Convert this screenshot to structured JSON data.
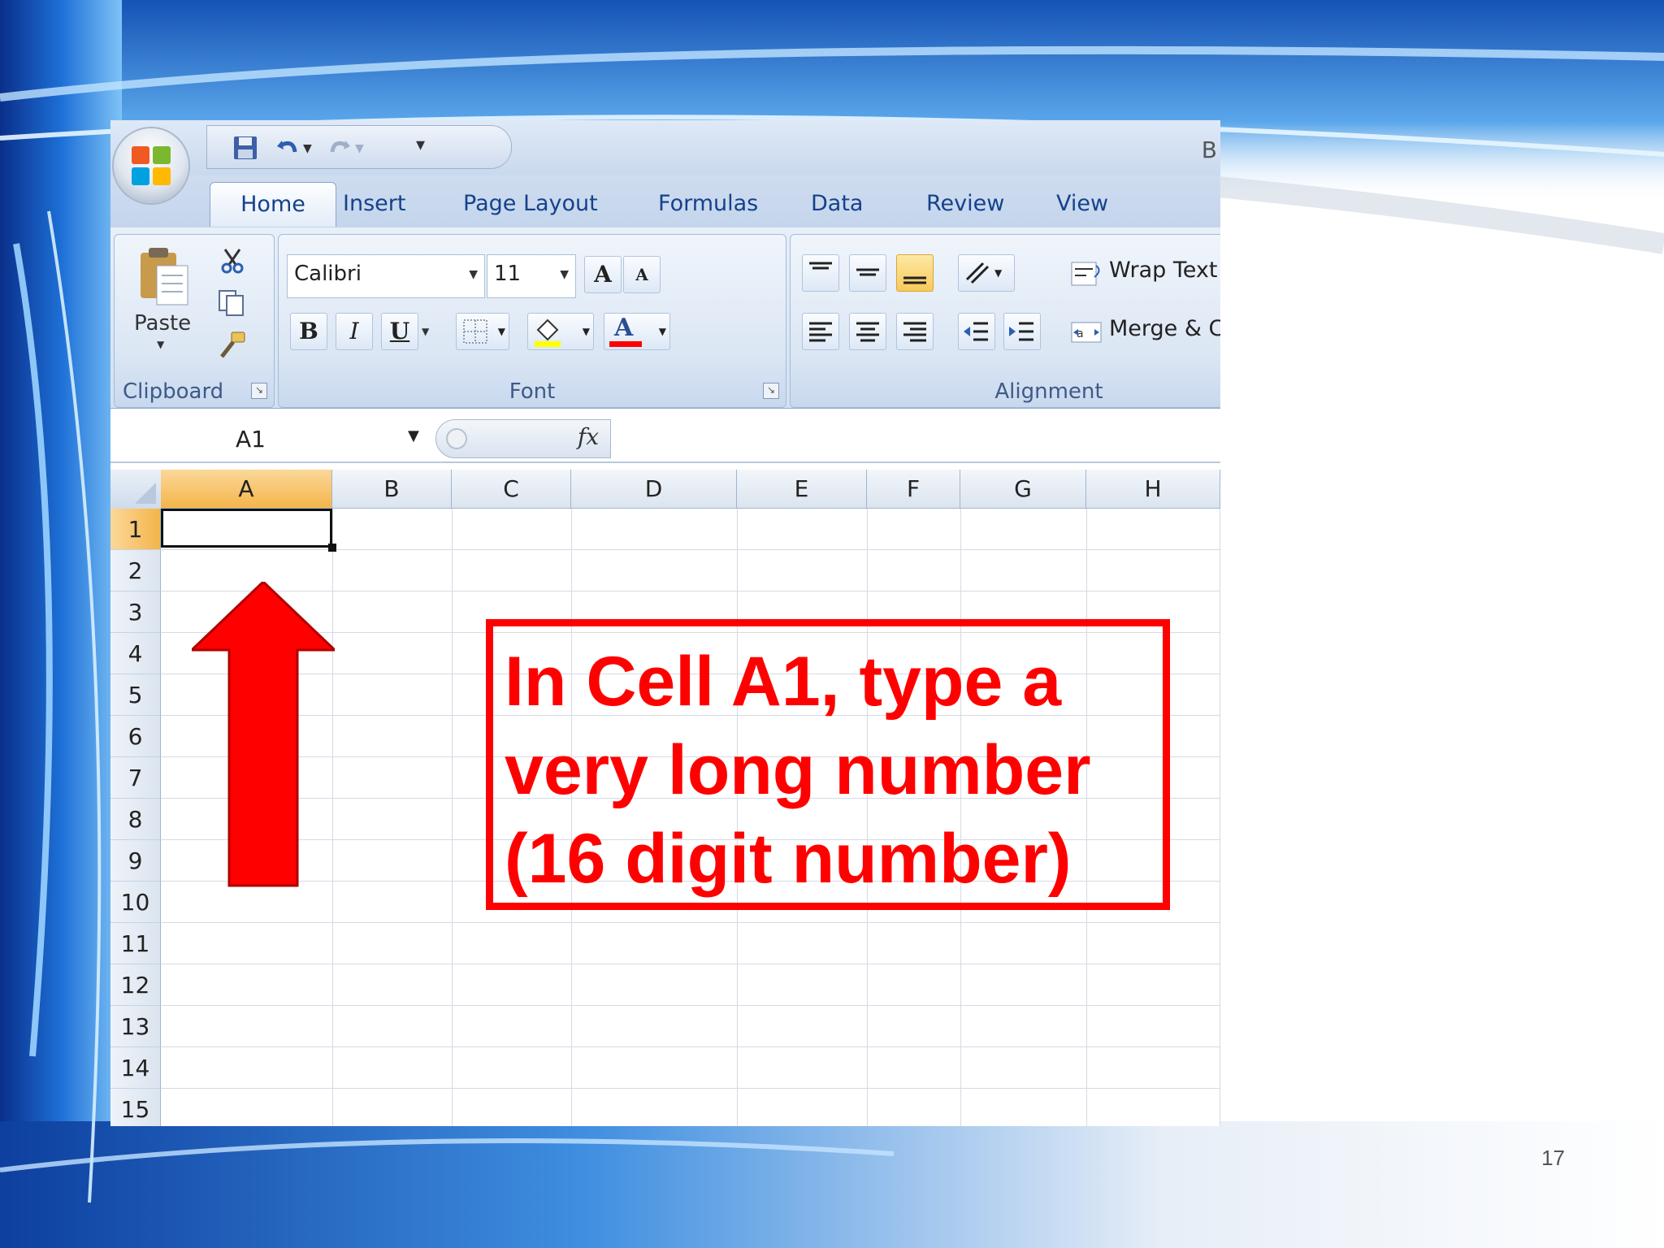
{
  "slide": {
    "page_number": "17"
  },
  "title_bar": {
    "partial_title": "B"
  },
  "quick_access": {
    "save": "save-icon",
    "undo": "undo-icon",
    "redo": "redo-icon",
    "customize": "▾"
  },
  "tabs": [
    {
      "label": "Home",
      "active": true
    },
    {
      "label": "Insert"
    },
    {
      "label": "Page Layout"
    },
    {
      "label": "Formulas"
    },
    {
      "label": "Data"
    },
    {
      "label": "Review"
    },
    {
      "label": "View"
    }
  ],
  "ribbon": {
    "clipboard": {
      "paste_label": "Paste",
      "group_label": "Clipboard"
    },
    "font": {
      "font_name": "Calibri",
      "font_size": "11",
      "group_label": "Font",
      "bold": "B",
      "italic": "I",
      "underline": "U",
      "grow": "A",
      "shrink": "A",
      "font_color": "A",
      "fill_color_hex": "#ffff00",
      "font_color_hex": "#ff0000"
    },
    "alignment": {
      "wrap_text": "Wrap Text",
      "merge_center": "Merge & Center",
      "group_label": "Alignment"
    }
  },
  "formula_bar": {
    "name_box": "A1",
    "fx_label": "fx",
    "formula": ""
  },
  "sheet": {
    "columns": [
      "A",
      "B",
      "C",
      "D",
      "E",
      "F",
      "G",
      "H"
    ],
    "rows": [
      "1",
      "2",
      "3",
      "4",
      "5",
      "6",
      "7",
      "8",
      "9",
      "10",
      "11",
      "12",
      "13",
      "14",
      "15"
    ],
    "active_cell": "A1"
  },
  "annotation": {
    "text_line1": "In Cell A1, type a",
    "text_line2": "very long number",
    "text_line3": "(16 digit number)",
    "color": "#ff0000"
  }
}
